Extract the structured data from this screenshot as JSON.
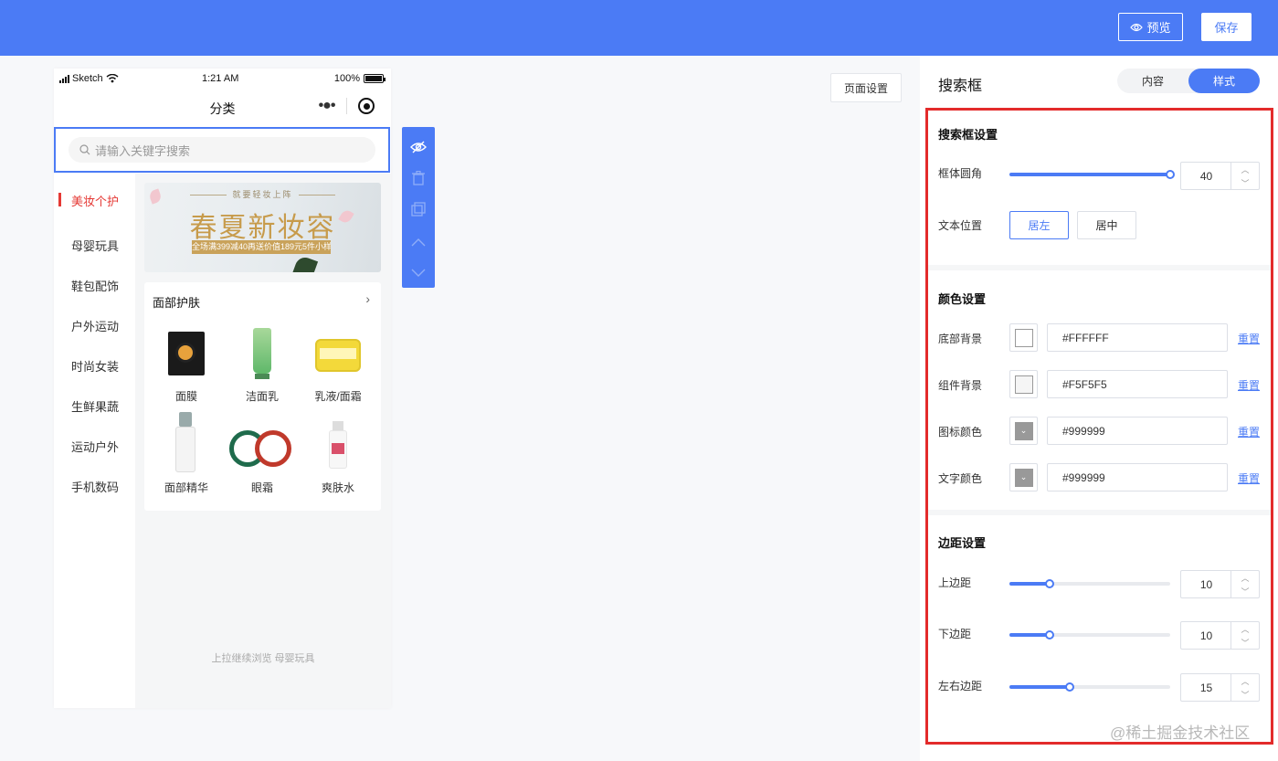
{
  "topbar": {
    "preview_label": "预览",
    "save_label": "保存"
  },
  "canvas": {
    "page_settings_label": "页面设置"
  },
  "phone": {
    "carrier": "Sketch",
    "time": "1:21 AM",
    "battery": "100%",
    "nav_title": "分类",
    "search_placeholder": "请输入关键字搜索",
    "categories": [
      "美妆个护",
      "母婴玩具",
      "鞋包配饰",
      "户外运动",
      "时尚女装",
      "生鲜果蔬",
      "运动户外",
      "手机数码"
    ],
    "banner": {
      "subtitle": "就要轻妆上阵",
      "title": "春夏新妆容",
      "strip": "全场满399减40再送价值189元5件小样"
    },
    "card_title": "面部护肤",
    "products": [
      "面膜",
      "洁面乳",
      "乳液/面霜",
      "面部精华",
      "眼霜",
      "爽肤水"
    ],
    "load_more": "上拉继续浏览 母婴玩具"
  },
  "panel": {
    "title": "搜索框",
    "tabs": [
      "内容",
      "样式"
    ],
    "active_tab": "样式",
    "search_settings": {
      "title": "搜索框设置",
      "radius_label": "框体圆角",
      "radius_value": "40",
      "radius_fraction": 1.0,
      "text_position_label": "文本位置",
      "align_left": "居左",
      "align_center": "居中"
    },
    "color_settings": {
      "title": "颜色设置",
      "reset_label": "重置",
      "rows": [
        {
          "label": "底部背景",
          "value": "#FFFFFF",
          "swatch": "#FFFFFF"
        },
        {
          "label": "组件背景",
          "value": "#F5F5F5",
          "swatch": "#F5F5F5"
        },
        {
          "label": "图标颜色",
          "value": "#999999",
          "swatch": "#999999"
        },
        {
          "label": "文字颜色",
          "value": "#999999",
          "swatch": "#999999"
        }
      ]
    },
    "margin_settings": {
      "title": "边距设置",
      "rows": [
        {
          "label": "上边距",
          "value": "10",
          "fraction": 0.25
        },
        {
          "label": "下边距",
          "value": "10",
          "fraction": 0.25
        },
        {
          "label": "左右边距",
          "value": "15",
          "fraction": 0.375
        }
      ]
    }
  },
  "watermark": "@稀土掘金技术社区",
  "colors": {
    "accent": "#4b7bf5",
    "highlight": "#e32b2b",
    "active_category": "#e53935"
  }
}
